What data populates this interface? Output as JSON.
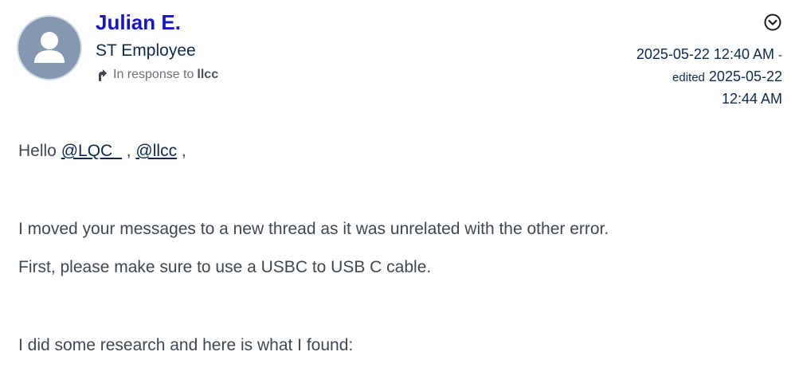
{
  "author": {
    "name": "Julian E.",
    "rank": "ST Employee",
    "in_response_prefix": "In response to",
    "in_response_to": "llcc"
  },
  "meta": {
    "posted": "2025-05-22 12:40 AM",
    "dash": "-",
    "edited_label": "edited",
    "edited_date": "2025-05-22",
    "edited_time": "12:44 AM",
    "options_icon": "chevron-down-circle-icon"
  },
  "body": {
    "greeting": "Hello",
    "mention_1": "@LQC_",
    "separator": ",",
    "mention_2": "@llcc",
    "trailing": ",",
    "paragraph_1": "I moved your messages to a new thread as it was unrelated with the other error.",
    "paragraph_2": "First, please make sure to use a USBC to USB C cable.",
    "paragraph_3": "I did some research and here is what I found:"
  },
  "colors": {
    "author_name": "#1616c4",
    "avatar_bg": "#8499b1",
    "text_dark": "#0d2a4e",
    "body_text": "#3f4852"
  }
}
